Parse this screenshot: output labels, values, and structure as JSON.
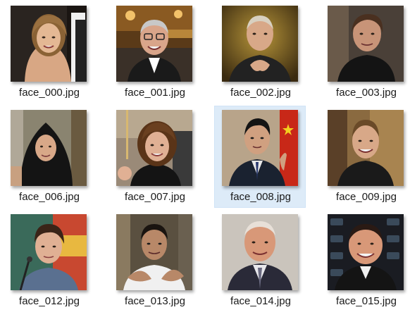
{
  "files": [
    {
      "name": "face_000.jpg",
      "icon": "photo-thumbnail-woman-smiling",
      "selected": false
    },
    {
      "name": "face_001.jpg",
      "icon": "photo-thumbnail-man-glasses-festival",
      "selected": false
    },
    {
      "name": "face_002.jpg",
      "icon": "photo-thumbnail-man-hands-clasped",
      "selected": false
    },
    {
      "name": "face_003.jpg",
      "icon": "photo-thumbnail-man-dark-shirt",
      "selected": false
    },
    {
      "name": "face_006.jpg",
      "icon": "photo-thumbnail-woman-headscarf",
      "selected": false
    },
    {
      "name": "face_007.jpg",
      "icon": "photo-thumbnail-woman-brown-hair",
      "selected": false
    },
    {
      "name": "face_008.jpg",
      "icon": "photo-thumbnail-man-suit-flag",
      "selected": true
    },
    {
      "name": "face_009.jpg",
      "icon": "photo-thumbnail-young-man-smiling",
      "selected": false
    },
    {
      "name": "face_012.jpg",
      "icon": "photo-thumbnail-boy-microphone",
      "selected": false
    },
    {
      "name": "face_013.jpg",
      "icon": "photo-thumbnail-man-crowd",
      "selected": false
    },
    {
      "name": "face_014.jpg",
      "icon": "photo-thumbnail-older-man-suit",
      "selected": false
    },
    {
      "name": "face_015.jpg",
      "icon": "photo-thumbnail-man-press-backdrop",
      "selected": false
    }
  ],
  "colors": {
    "selection_background": "#ddebf8",
    "selection_border": "#cfe3f6",
    "label_text": "#1a1a1a"
  }
}
